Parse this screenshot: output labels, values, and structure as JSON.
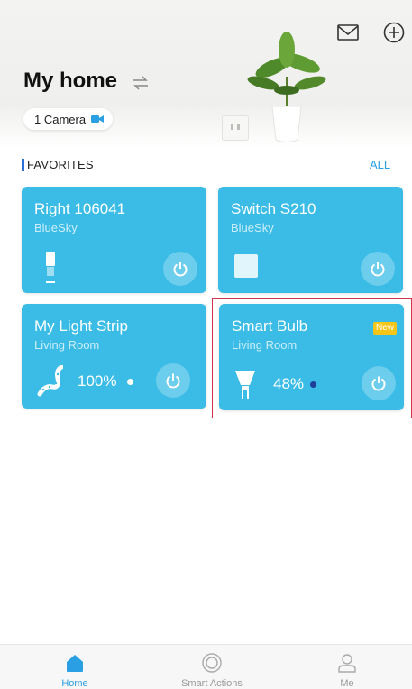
{
  "header": {
    "title": "My home",
    "camera_pill": "1 Camera"
  },
  "favorites": {
    "title": "FAVORITES",
    "all_link": "ALL"
  },
  "devices": [
    {
      "name": "Right 106041",
      "location": "BlueSky",
      "icon": "light-switch-icon",
      "has_power": true
    },
    {
      "name": "Switch S210",
      "location": "BlueSky",
      "icon": "switch-panel-icon",
      "has_power": true
    },
    {
      "name": "My Light Strip",
      "location": "Living Room",
      "icon": "light-strip-icon",
      "brightness": "100%",
      "has_power": true
    },
    {
      "name": "Smart Bulb",
      "location": "Living Room",
      "icon": "bulb-icon",
      "brightness": "48%",
      "badge": "New",
      "has_power": true
    }
  ],
  "tabbar": {
    "tabs": [
      {
        "label": "Home",
        "icon": "home-icon",
        "active": true
      },
      {
        "label": "Smart Actions",
        "icon": "smart-actions-icon",
        "active": false
      },
      {
        "label": "Me",
        "icon": "user-icon",
        "active": false
      }
    ]
  },
  "colors": {
    "card": "#3bbce6",
    "accent": "#2a9fe3",
    "badge": "#f5c518",
    "highlight": "#d0344a"
  }
}
